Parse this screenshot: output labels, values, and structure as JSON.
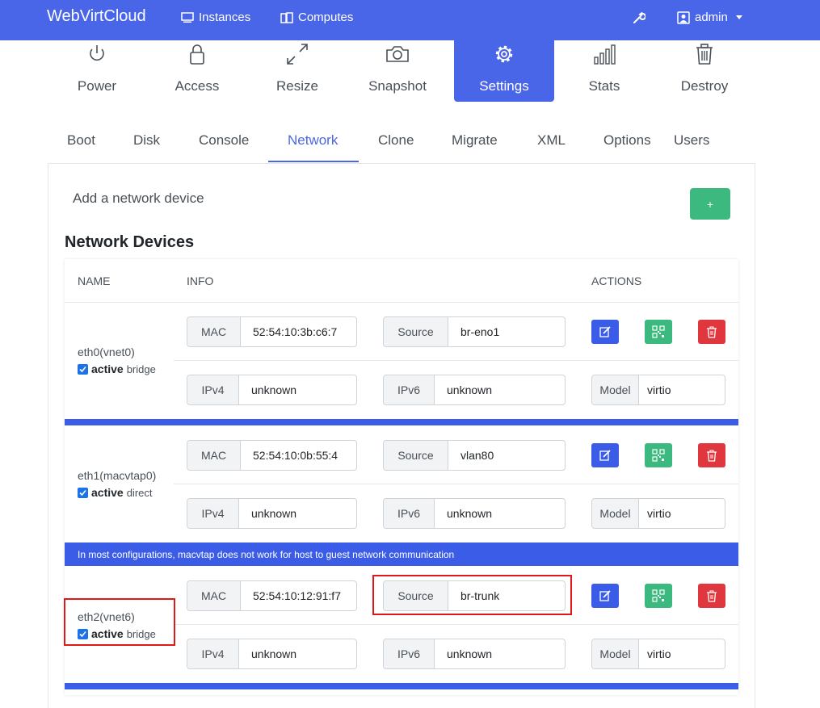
{
  "navbar": {
    "brand": "WebVirtCloud",
    "instances": "Instances",
    "computes": "Computes",
    "user": "admin"
  },
  "actions": [
    {
      "label": "Power",
      "icon": "power-icon"
    },
    {
      "label": "Access",
      "icon": "lock-icon"
    },
    {
      "label": "Resize",
      "icon": "resize-icon"
    },
    {
      "label": "Snapshot",
      "icon": "camera-icon"
    },
    {
      "label": "Settings",
      "icon": "gear-icon"
    },
    {
      "label": "Stats",
      "icon": "chart-icon"
    },
    {
      "label": "Destroy",
      "icon": "trash-icon"
    }
  ],
  "tabs": [
    "Boot",
    "Disk",
    "Console",
    "Network",
    "Clone",
    "Migrate",
    "XML",
    "Options",
    "Users"
  ],
  "add_network": {
    "label": "Add a network device",
    "button": "+"
  },
  "section_title": "Network Devices",
  "table_headers": {
    "name": "NAME",
    "info": "INFO",
    "actions": "ACTIONS"
  },
  "labels": {
    "mac": "MAC",
    "source": "Source",
    "ipv4": "IPv4",
    "ipv6": "IPv6",
    "model": "Model",
    "active": "active"
  },
  "devices": [
    {
      "name": "eth0(vnet0)",
      "type": "bridge",
      "mac": "52:54:10:3b:c6:7",
      "source": "br-eno1",
      "ipv4": "unknown",
      "ipv6": "unknown",
      "model": "virtio"
    },
    {
      "name": "eth1(macvtap0)",
      "type": "direct",
      "mac": "52:54:10:0b:55:4",
      "source": "vlan80",
      "ipv4": "unknown",
      "ipv6": "unknown",
      "model": "virtio"
    },
    {
      "name": "eth2(vnet6)",
      "type": "bridge",
      "mac": "52:54:10:12:91:f7",
      "source": "br-trunk",
      "ipv4": "unknown",
      "ipv6": "unknown",
      "model": "virtio"
    }
  ],
  "macvtap_note": "In most configurations, macvtap does not work for host to guest network communication",
  "colors": {
    "primary": "#4a66e8",
    "success": "#3cb97f",
    "danger": "#e0363d",
    "highlight": "#e01818"
  }
}
